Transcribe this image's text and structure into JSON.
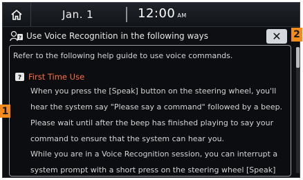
{
  "status_bar": {
    "date": "Jan.  1",
    "time": "12:00",
    "ampm": "AM"
  },
  "title_bar": {
    "title": "Use Voice Recognition in the following ways",
    "close_label": "✕"
  },
  "content": {
    "intro": "Refer to the following help guide to use voice commands.",
    "section_title": "First Time Use",
    "first_time_text": "When you press the [Speak] button on the steering wheel, you'll hear the system say \"Please say a command\" followed by a beep. Please wait until after the beep has finished playing to say your command to ensure that the system can hear you.",
    "session_text": "While you are in a Voice Recognition session, you can interrupt a system prompt with a short press on the steering wheel [Speak]"
  },
  "callouts": {
    "one": "1",
    "two": "2"
  },
  "colors": {
    "accent": "#ff6f3f",
    "callout": "#f28a1c",
    "background": "#0d0f12"
  },
  "icons": [
    "home-icon",
    "voice-help-icon",
    "close-icon",
    "help-badge-icon"
  ]
}
